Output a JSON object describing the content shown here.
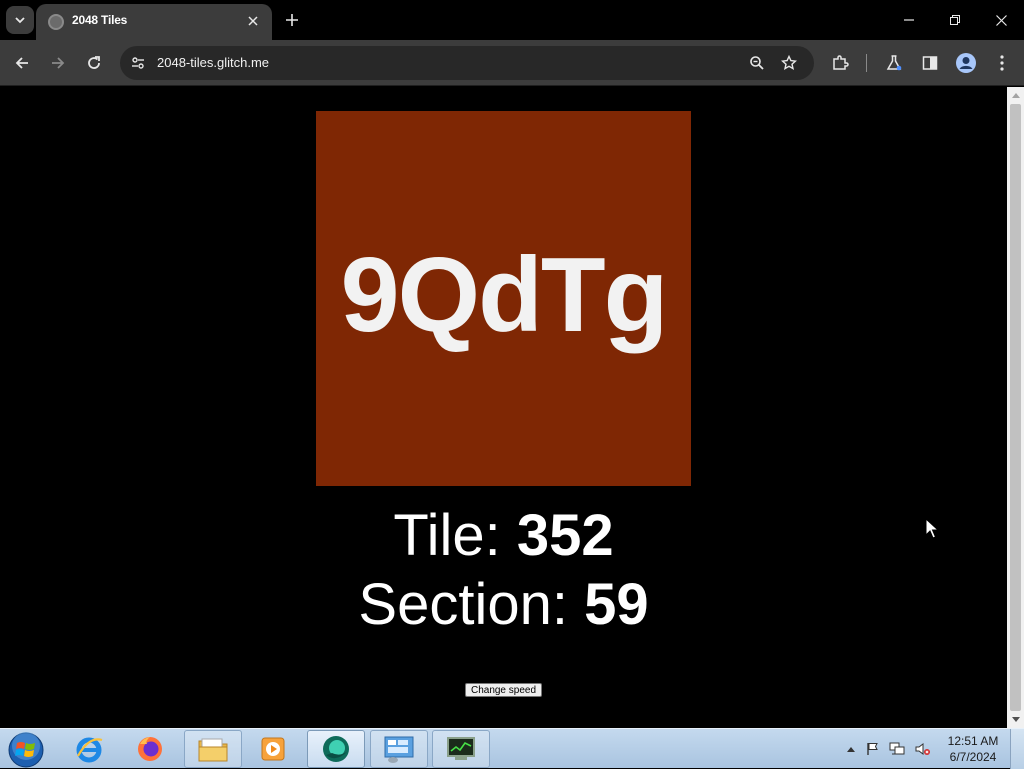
{
  "browser": {
    "tab": {
      "title": "2048 Tiles"
    },
    "address_bar": {
      "url": "2048-tiles.glitch.me"
    }
  },
  "page": {
    "tile": {
      "text": "9QdTg",
      "color": "#7f2704"
    },
    "tile_label": "Tile:",
    "tile_value": "352",
    "section_label": "Section:",
    "section_value": "59",
    "change_speed_label": "Change speed"
  },
  "taskbar": {
    "items": [
      "internet-explorer",
      "firefox",
      "file-explorer",
      "media-player",
      "chrome-app",
      "control-panel",
      "task-manager"
    ],
    "clock": {
      "time": "12:51 AM",
      "date": "6/7/2024"
    }
  },
  "colors": {
    "page_background": "#000000",
    "toolbar": "#3c3c3c",
    "tile": "#7f2704"
  }
}
